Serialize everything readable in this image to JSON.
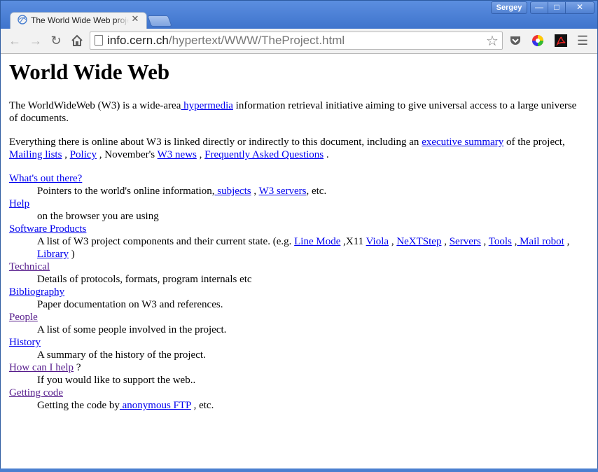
{
  "window": {
    "user": "Sergey"
  },
  "tab": {
    "title": "The World Wide Web project"
  },
  "omnibox": {
    "host": "info.cern.ch",
    "path": "/hypertext/WWW/TheProject.html"
  },
  "page": {
    "title": "World Wide Web",
    "intro": {
      "t1": "The WorldWideWeb (W3) is a wide-area",
      "link_hypermedia": " hypermedia",
      "t2": " information retrieval initiative aiming to give universal access to a large universe of documents."
    },
    "para2": {
      "t1": "Everything there is online about W3 is linked directly or indirectly to this document, including an ",
      "link_summary": "executive summary",
      "t2": " of the project, ",
      "link_mailing": "Mailing lists",
      "t3": " , ",
      "link_policy": "Policy",
      "t4": " , November's ",
      "link_news": "W3 news",
      "t5": " , ",
      "link_faq": "Frequently Asked Questions",
      "t6": " ."
    },
    "items": [
      {
        "term": "What's out there?",
        "desc_t1": "Pointers to the world's online information,",
        "link_subjects": " subjects",
        "desc_t2": " , ",
        "link_servers": "W3 servers",
        "desc_t3": ", etc."
      },
      {
        "term": "Help",
        "desc": "on the browser you are using"
      },
      {
        "term": "Software Products",
        "desc_t1": "A list of W3 project components and their current state. (e.g. ",
        "link_linemode": "Line Mode",
        "desc_t2": " ,X11 ",
        "link_viola": "Viola",
        "desc_t3": " , ",
        "link_next": "NeXTStep",
        "desc_t4": " , ",
        "link_servers": "Servers",
        "desc_t5": " , ",
        "link_tools": "Tools",
        "desc_t6": " ,",
        "link_mailrobot": " Mail robot",
        "desc_t7": " ,",
        "link_library": " Library",
        "desc_t8": " )"
      },
      {
        "term": "Technical",
        "desc": "Details of protocols, formats, program internals etc"
      },
      {
        "term": "Bibliography",
        "desc": "Paper documentation on W3 and references."
      },
      {
        "term": "People",
        "desc": "A list of some people involved in the project."
      },
      {
        "term": "History",
        "desc": "A summary of the history of the project."
      },
      {
        "term": "How can I help",
        "term_suffix": " ?",
        "desc": "If you would like to support the web.."
      },
      {
        "term": "Getting code",
        "desc_t1": "Getting the code by",
        "link_ftp": " anonymous FTP",
        "desc_t2": " , etc."
      }
    ]
  }
}
